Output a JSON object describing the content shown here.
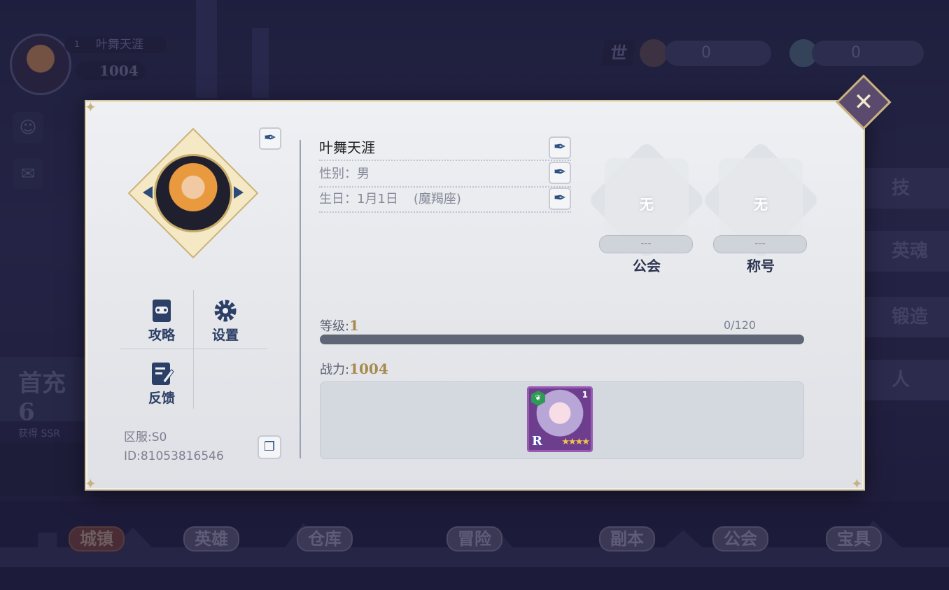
{
  "background": {
    "player_name": "叶舞天涯",
    "player_level": "1",
    "player_power": "1004",
    "currency_badge": "世",
    "currency_1_value": "0",
    "currency_2_value": "0",
    "promo_title": "首充6",
    "promo_sub": "获得 SSR",
    "right_tabs": [
      "技",
      "英魂",
      "锻造",
      "人"
    ],
    "nav_items": [
      "城镇",
      "英雄",
      "仓库",
      "冒险",
      "副本",
      "公会",
      "宝具"
    ]
  },
  "profile": {
    "name": "叶舞天涯",
    "gender_label": "性别：",
    "gender_value": "男",
    "birthday_label": "生日：",
    "birthday_value": "1月1日",
    "zodiac": "(魔羯座)",
    "guild_emblem_text": "无",
    "guild_value": "---",
    "guild_caption": "公会",
    "title_emblem_text": "无",
    "title_value": "---",
    "title_caption": "称号",
    "level_label": "等级:",
    "level_value": "1",
    "exp_text": "0/120",
    "exp_fraction": 0,
    "power_label": "战力:",
    "power_value": "1004",
    "server": "区服:S0",
    "player_id": "ID:81053816546"
  },
  "menu": {
    "guide": "攻略",
    "settings": "设置",
    "feedback": "反馈"
  },
  "hero_card": {
    "level": "1",
    "rarity": "R",
    "stars": "★★★★",
    "element_icon": "leaf-icon"
  },
  "icons": {
    "close": "close-icon",
    "edit": "feather-pen-icon",
    "copy": "copy-icon"
  },
  "colors": {
    "accent_gold": "#a78a4f",
    "edit_blue": "#2d4f84",
    "exp_bar_bg": "#5f6676"
  }
}
